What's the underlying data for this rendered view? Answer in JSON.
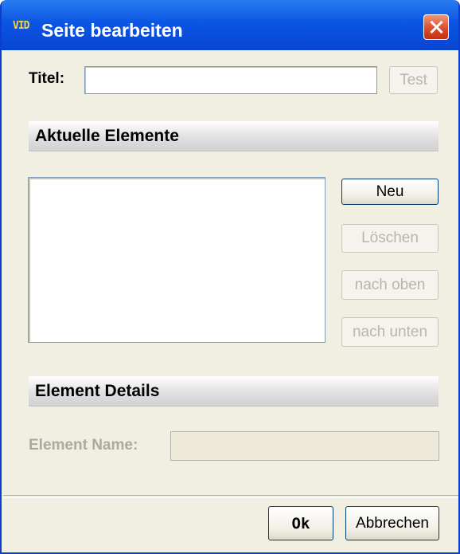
{
  "window": {
    "title": "Seite bearbeiten",
    "icon_text": "VID"
  },
  "form": {
    "title_label": "Titel:",
    "title_value": "",
    "test_button": "Test"
  },
  "sections": {
    "current_elements": "Aktuelle Elemente",
    "element_details": "Element Details"
  },
  "element_buttons": {
    "new": "Neu",
    "delete": "Löschen",
    "move_up": "nach oben",
    "move_down": "nach unten"
  },
  "details": {
    "name_label": "Element Name:",
    "name_value": ""
  },
  "footer": {
    "ok": "Ok",
    "cancel": "Abbrechen"
  },
  "colors": {
    "titlebar": "#0b55e3",
    "dialog_bg": "#f1efe2",
    "close_button": "#de4b2a"
  }
}
